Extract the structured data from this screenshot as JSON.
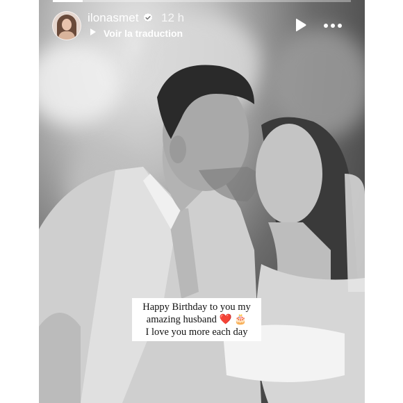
{
  "story": {
    "username": "ilonasmet",
    "time": "12 h",
    "translate_label": "Voir la traduction",
    "progress": 0.1
  },
  "icons": {
    "avatar": "avatar",
    "verified": "verified-badge-icon",
    "translate": "translate-icon",
    "play": "play-icon",
    "more": "more-icon"
  },
  "caption": {
    "line1": "Happy Birthday to you my",
    "line2": "amazing husband",
    "line2_emoji_heart": "❤️",
    "line2_emoji_cake": "🎂",
    "line3": "I love you more each day"
  },
  "colors": {
    "text": "#ffffff",
    "heart": "#d21f2a"
  }
}
